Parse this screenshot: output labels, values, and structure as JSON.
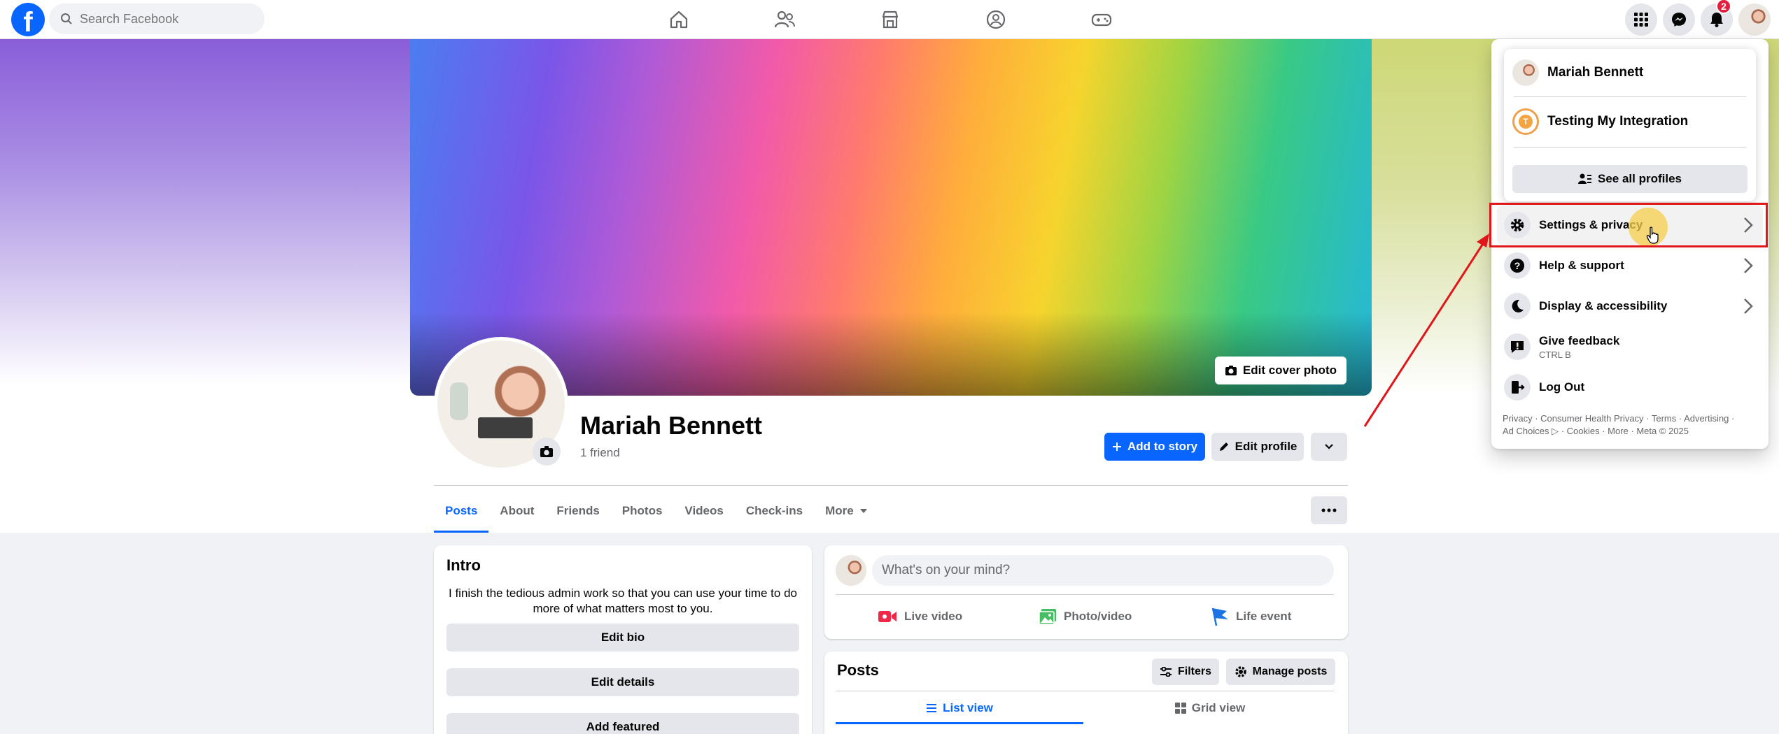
{
  "search": {
    "placeholder": "Search Facebook"
  },
  "notifications": {
    "badge_count": "2"
  },
  "profile": {
    "name": "Mariah Bennett",
    "friends": "1 friend",
    "edit_cover_label": "Edit cover photo",
    "add_story_label": "Add to story",
    "edit_profile_label": "Edit profile"
  },
  "tabs": [
    {
      "label": "Posts"
    },
    {
      "label": "About"
    },
    {
      "label": "Friends"
    },
    {
      "label": "Photos"
    },
    {
      "label": "Videos"
    },
    {
      "label": "Check-ins"
    },
    {
      "label": "More"
    }
  ],
  "intro": {
    "title": "Intro",
    "bio": "I finish the tedious admin work so that you can use your time to do more of what matters most to you.",
    "edit_bio_label": "Edit bio",
    "edit_details_label": "Edit details",
    "add_featured_label": "Add featured"
  },
  "composer": {
    "placeholder": "What's on your mind?",
    "live_video_label": "Live video",
    "photo_video_label": "Photo/video",
    "life_event_label": "Life event"
  },
  "posts_panel": {
    "title": "Posts",
    "filters_label": "Filters",
    "manage_label": "Manage posts",
    "list_view_label": "List view",
    "grid_view_label": "Grid view"
  },
  "account_menu": {
    "profiles": [
      {
        "name": "Mariah Bennett"
      },
      {
        "name": "Testing My Integration"
      }
    ],
    "see_all_label": "See all profiles",
    "items": [
      {
        "label": "Settings & privacy",
        "icon": "gear-icon"
      },
      {
        "label": "Help & support",
        "icon": "question-icon"
      },
      {
        "label": "Display & accessibility",
        "icon": "moon-icon"
      },
      {
        "label": "Give feedback",
        "sub": "CTRL B",
        "icon": "feedback-icon"
      },
      {
        "label": "Log Out",
        "icon": "logout-icon"
      }
    ],
    "footer_line1": "Privacy · Consumer Health Privacy · Terms · Advertising ·",
    "footer_line2": "Ad Choices ▷ · Cookies · More · Meta © 2025"
  },
  "colors": {
    "brand": "#0866ff",
    "annotation": "#e0161b"
  }
}
